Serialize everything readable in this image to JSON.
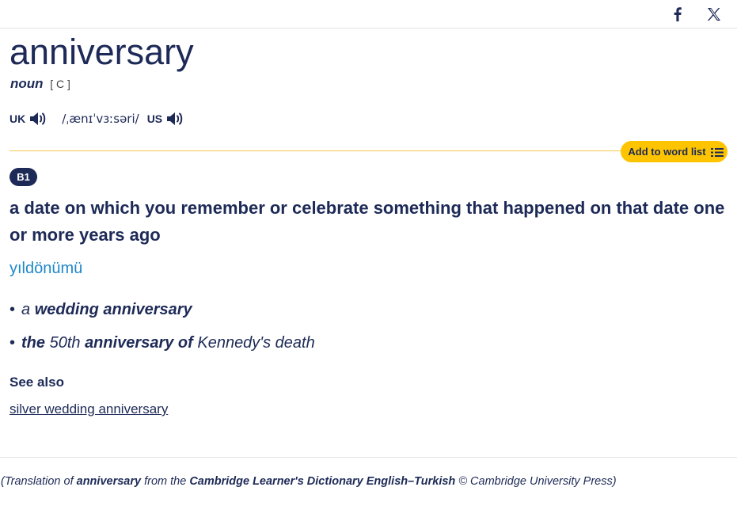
{
  "social": {
    "facebook_icon": "facebook-icon",
    "x_icon": "x-icon"
  },
  "entry": {
    "headword": "anniversary",
    "pos": "noun",
    "grammar": "[ C ]",
    "pronunciation": {
      "uk_label": "UK",
      "us_label": "US",
      "ipa": "/ˌænɪˈvɜːsəri/"
    },
    "add_to_word_list": "Add to word list",
    "level": "B1",
    "definition": "a date on which you remember or celebrate something that happened on that date one or more years ago",
    "translation": "yıldönümü",
    "examples": [
      {
        "bullet": "•",
        "parts": [
          {
            "text": "a ",
            "bold": false
          },
          {
            "text": "wedding anniversary",
            "bold": true
          }
        ]
      },
      {
        "bullet": "•",
        "parts": [
          {
            "text": "the",
            "bold": true
          },
          {
            "text": " 50th ",
            "bold": false
          },
          {
            "text": "anniversary of",
            "bold": true
          },
          {
            "text": " Kennedy's death",
            "bold": false
          }
        ]
      }
    ],
    "see_also_label": "See also",
    "see_also_link": "silver wedding anniversary"
  },
  "credit": {
    "prefix": "(Translation of ",
    "word": "anniversary",
    "middle": " from the ",
    "dictionary": "Cambridge Learner's Dictionary English–Turkish",
    "suffix": " © Cambridge University Press)"
  },
  "colors": {
    "navy": "#1d2a57",
    "translation_blue": "#1e88c9",
    "accent_yellow": "#fec400",
    "divider_yellow": "#f2c94c"
  }
}
